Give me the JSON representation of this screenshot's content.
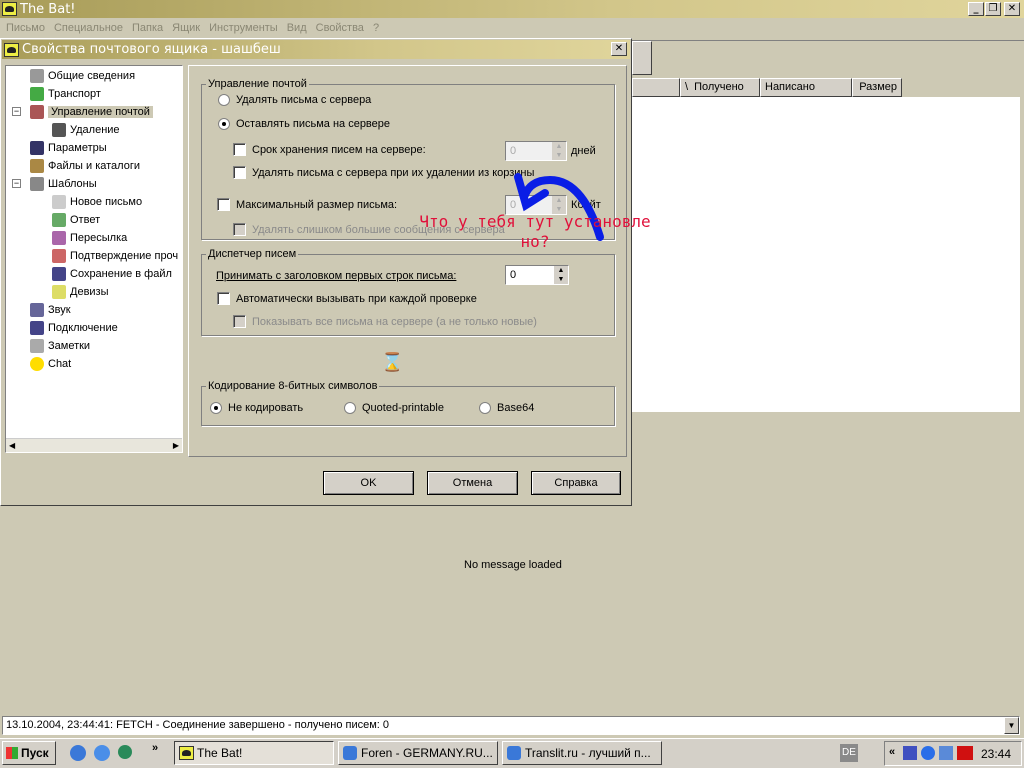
{
  "main_window": {
    "title": "The Bat!",
    "menu": [
      "Письмо",
      "Специальное",
      "Папка",
      "Ящик",
      "Инструменты",
      "Вид",
      "Свойства",
      "?"
    ],
    "columns": [
      "Получено",
      "Написано",
      "Размер"
    ],
    "preview_text": "No message loaded",
    "status_text": "13.10.2004, 23:44:41: FETCH - Соединение завершено - получено писем: 0"
  },
  "dialog": {
    "title": "Свойства почтового ящика - шашбеш",
    "tree": [
      {
        "label": "Общие сведения",
        "icon": "user-icon",
        "level": 0
      },
      {
        "label": "Транспорт",
        "icon": "transport-icon",
        "level": 0
      },
      {
        "label": "Управление почтой",
        "icon": "tools-icon",
        "level": 0,
        "selected": true
      },
      {
        "label": "Удаление",
        "icon": "trash-icon",
        "level": 1
      },
      {
        "label": "Параметры",
        "icon": "options-icon",
        "level": 0
      },
      {
        "label": "Файлы и каталоги",
        "icon": "folders-icon",
        "level": 0
      },
      {
        "label": "Шаблоны",
        "icon": "template-icon",
        "level": 0
      },
      {
        "label": "Новое письмо",
        "icon": "document-icon",
        "level": 1
      },
      {
        "label": "Ответ",
        "icon": "reply-icon",
        "level": 1
      },
      {
        "label": "Пересылка",
        "icon": "forward-icon",
        "level": 1
      },
      {
        "label": "Подтверждение проч",
        "icon": "confirm-icon",
        "level": 1
      },
      {
        "label": "Сохранение в файл",
        "icon": "save-icon",
        "level": 1
      },
      {
        "label": "Девизы",
        "icon": "bulb-icon",
        "level": 1
      },
      {
        "label": "Звук",
        "icon": "sound-icon",
        "level": 0
      },
      {
        "label": "Подключение",
        "icon": "network-icon",
        "level": 0
      },
      {
        "label": "Заметки",
        "icon": "notes-icon",
        "level": 0
      },
      {
        "label": "Chat",
        "icon": "smiley-icon",
        "level": 0
      }
    ],
    "mail_group": {
      "legend": "Управление почтой",
      "delete_from_server": "Удалять письма с сервера",
      "leave_on_server": "Оставлять письма на сервере",
      "keep_days_label": "Срок хранения писем на сервере:",
      "keep_days_value": "0",
      "days_unit": "дней",
      "delete_on_trash": "Удалять письма с сервера при их удалении из корзины",
      "max_size_label": "Максимальный размер письма:",
      "max_size_value": "0",
      "size_unit": "Кбайт",
      "delete_large": "Удалять слишком большие сообщения с сервера"
    },
    "dispatcher_group": {
      "legend": "Диспетчер писем",
      "header_lines_label": "Принимать с заголовком первых строк письма:",
      "header_lines_value": "0",
      "auto_call": "Автоматически вызывать при каждой проверке",
      "show_all": "Показывать все письма на сервере (а не только новые)"
    },
    "encoding_group": {
      "legend": "Кодирование 8-битных символов",
      "options": [
        "Не кодировать",
        "Quoted-printable",
        "Base64"
      ],
      "selected": "Не кодировать"
    },
    "buttons": {
      "ok": "OK",
      "cancel": "Отмена",
      "help": "Справка"
    }
  },
  "annotation": {
    "line1": "Что у тебя тут установле",
    "line2": "но?",
    "text_color": "#e0103a",
    "arrow_color": "#0a1ee6"
  },
  "taskbar": {
    "start": "Пуск",
    "tasks": [
      "The Bat!",
      "Foren - GERMANY.RU...",
      "Translit.ru - лучший п..."
    ],
    "lang": "DE",
    "clock": "23:44"
  }
}
